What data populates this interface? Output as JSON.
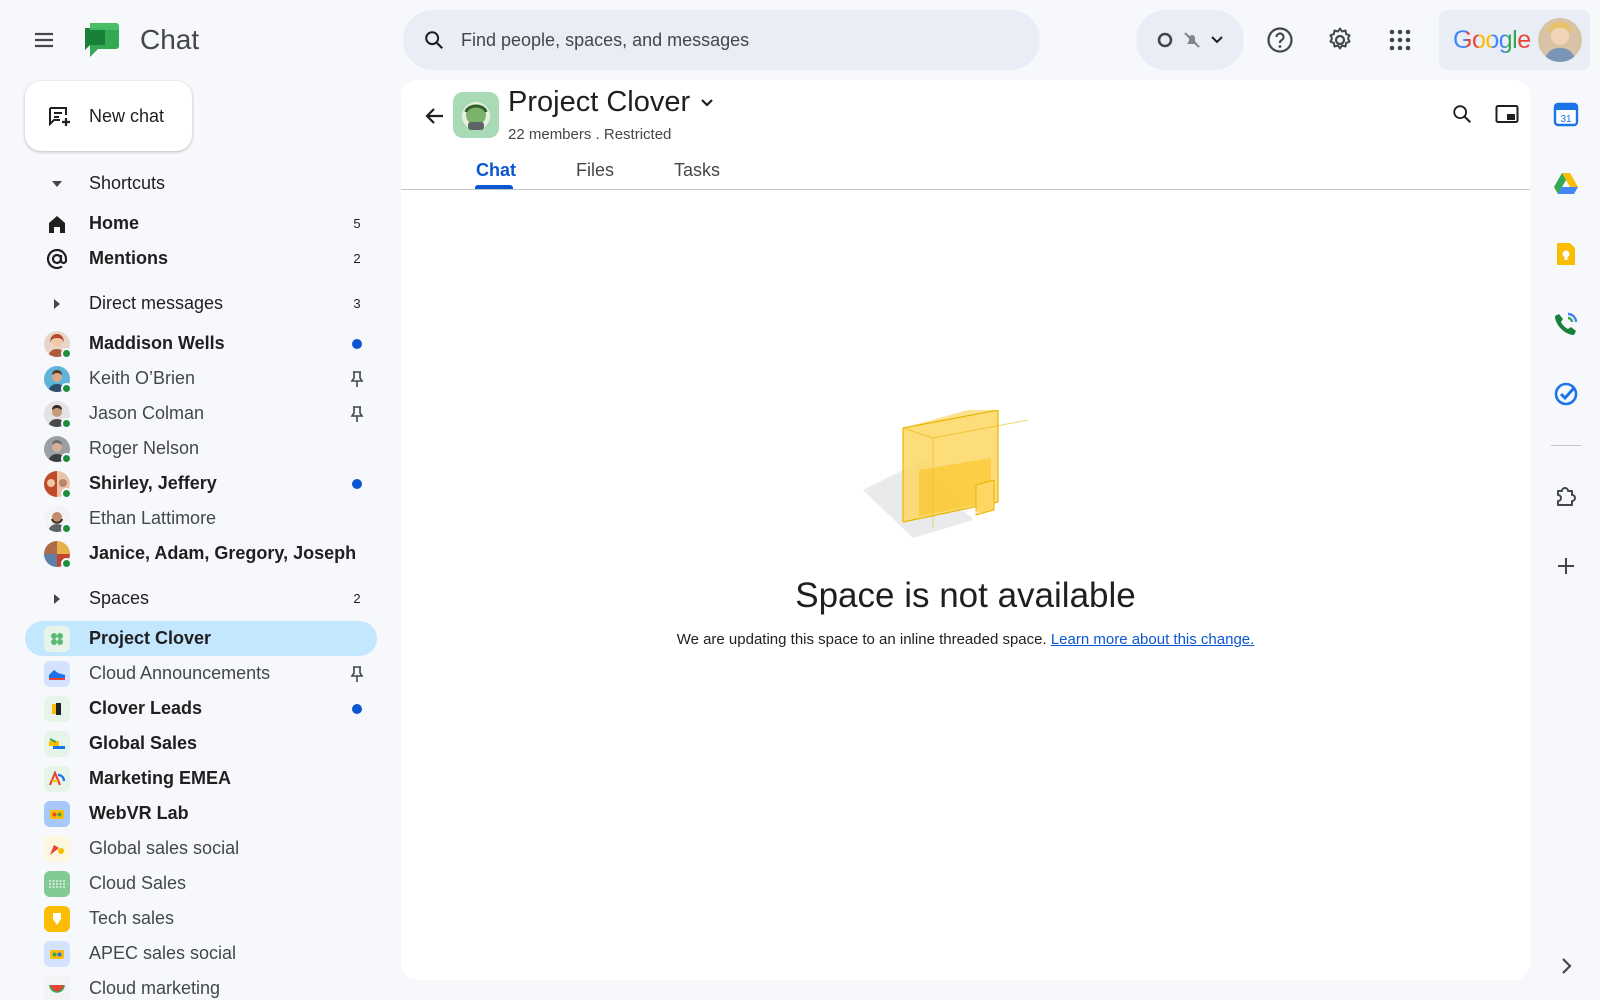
{
  "app": {
    "title": "Chat",
    "brand_color": "#0b57d0"
  },
  "search": {
    "placeholder": "Find people, spaces, and messages"
  },
  "account": {
    "brand": "Google"
  },
  "new_chat": {
    "label": "New chat"
  },
  "sidebar": {
    "shortcuts": {
      "label": "Shortcuts",
      "items": [
        {
          "label": "Home",
          "count": "5",
          "icon": "home-icon"
        },
        {
          "label": "Mentions",
          "count": "2",
          "icon": "at-icon"
        }
      ]
    },
    "direct_messages": {
      "label": "Direct messages",
      "count": "3",
      "items": [
        {
          "label": "Maddison Wells",
          "unread": true
        },
        {
          "label": "Keith O’Brien",
          "pinned": true
        },
        {
          "label": "Jason Colman",
          "pinned": true
        },
        {
          "label": "Roger Nelson"
        },
        {
          "label": "Shirley, Jeffery",
          "unread": true
        },
        {
          "label": "Ethan Lattimore"
        },
        {
          "label": "Janice, Adam, Gregory, Joseph",
          "unread": true
        }
      ]
    },
    "spaces": {
      "label": "Spaces",
      "count": "2",
      "items": [
        {
          "label": "Project Clover",
          "selected": true
        },
        {
          "label": "Cloud Announcements",
          "pinned": true
        },
        {
          "label": "Clover Leads",
          "unread": true
        },
        {
          "label": "Global Sales",
          "unread": true
        },
        {
          "label": "Marketing EMEA",
          "unread": true
        },
        {
          "label": "WebVR Lab",
          "unread": true
        },
        {
          "label": "Global sales social"
        },
        {
          "label": "Cloud Sales"
        },
        {
          "label": "Tech sales"
        },
        {
          "label": "APEC sales social"
        },
        {
          "label": "Cloud marketing"
        }
      ]
    }
  },
  "space": {
    "name": "Project Clover",
    "meta": "22 members . Restricted",
    "tabs": [
      "Chat",
      "Files",
      "Tasks"
    ],
    "active_tab": "Chat"
  },
  "empty_state": {
    "title": "Space is not available",
    "description": "We are updating this space to an inline threaded space.",
    "link": "Learn more about this change."
  }
}
